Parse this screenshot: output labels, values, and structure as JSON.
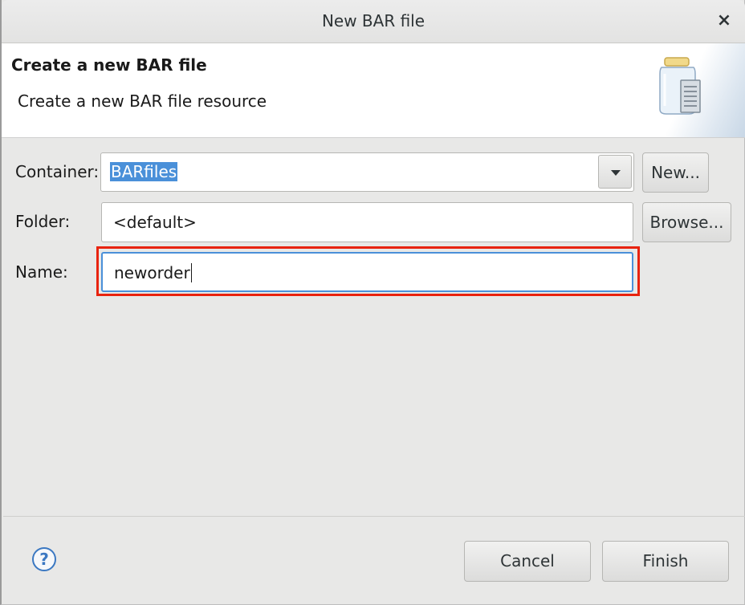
{
  "window": {
    "title": "New BAR file",
    "close_glyph": "×"
  },
  "banner": {
    "title": "Create a new BAR file",
    "description": "Create a new BAR file resource",
    "icon": "jar-archive-icon"
  },
  "form": {
    "container": {
      "label": "Container:",
      "value": "BARfiles",
      "new_button": "New..."
    },
    "folder": {
      "label": "Folder:",
      "value": "<default>",
      "browse_button": "Browse..."
    },
    "name": {
      "label": "Name:",
      "value": "neworder"
    }
  },
  "footer": {
    "help_glyph": "?",
    "cancel_button": "Cancel",
    "finish_button": "Finish"
  },
  "colors": {
    "selection": "#4a90d9",
    "highlight_box": "#e8230f",
    "focus_border": "#4a90d9"
  }
}
